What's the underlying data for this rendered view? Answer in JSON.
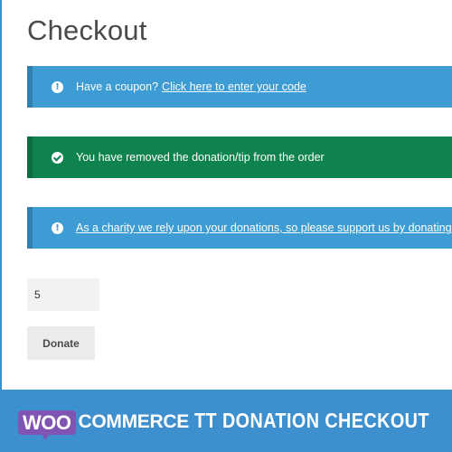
{
  "page": {
    "title": "Checkout"
  },
  "notices": {
    "coupon": {
      "text": "Have a coupon?",
      "link": "Click here to enter your code",
      "icon": "info-icon"
    },
    "removed": {
      "text": "You have removed the donation/tip from the order",
      "icon": "check-icon"
    },
    "charity": {
      "link": "As a charity we rely upon your donations, so please support us by donating what",
      "icon": "info-icon"
    }
  },
  "donation": {
    "amount_value": "5",
    "button_label": "Donate"
  },
  "banner": {
    "logo_woo": "WOO",
    "logo_commerce": "COMMERCE",
    "title": "TT DONATION CHECKOUT"
  },
  "colors": {
    "info": "#3d9cd3",
    "success": "#0f834d",
    "banner": "#3d8fce",
    "woo_purple": "#7f54b3"
  }
}
